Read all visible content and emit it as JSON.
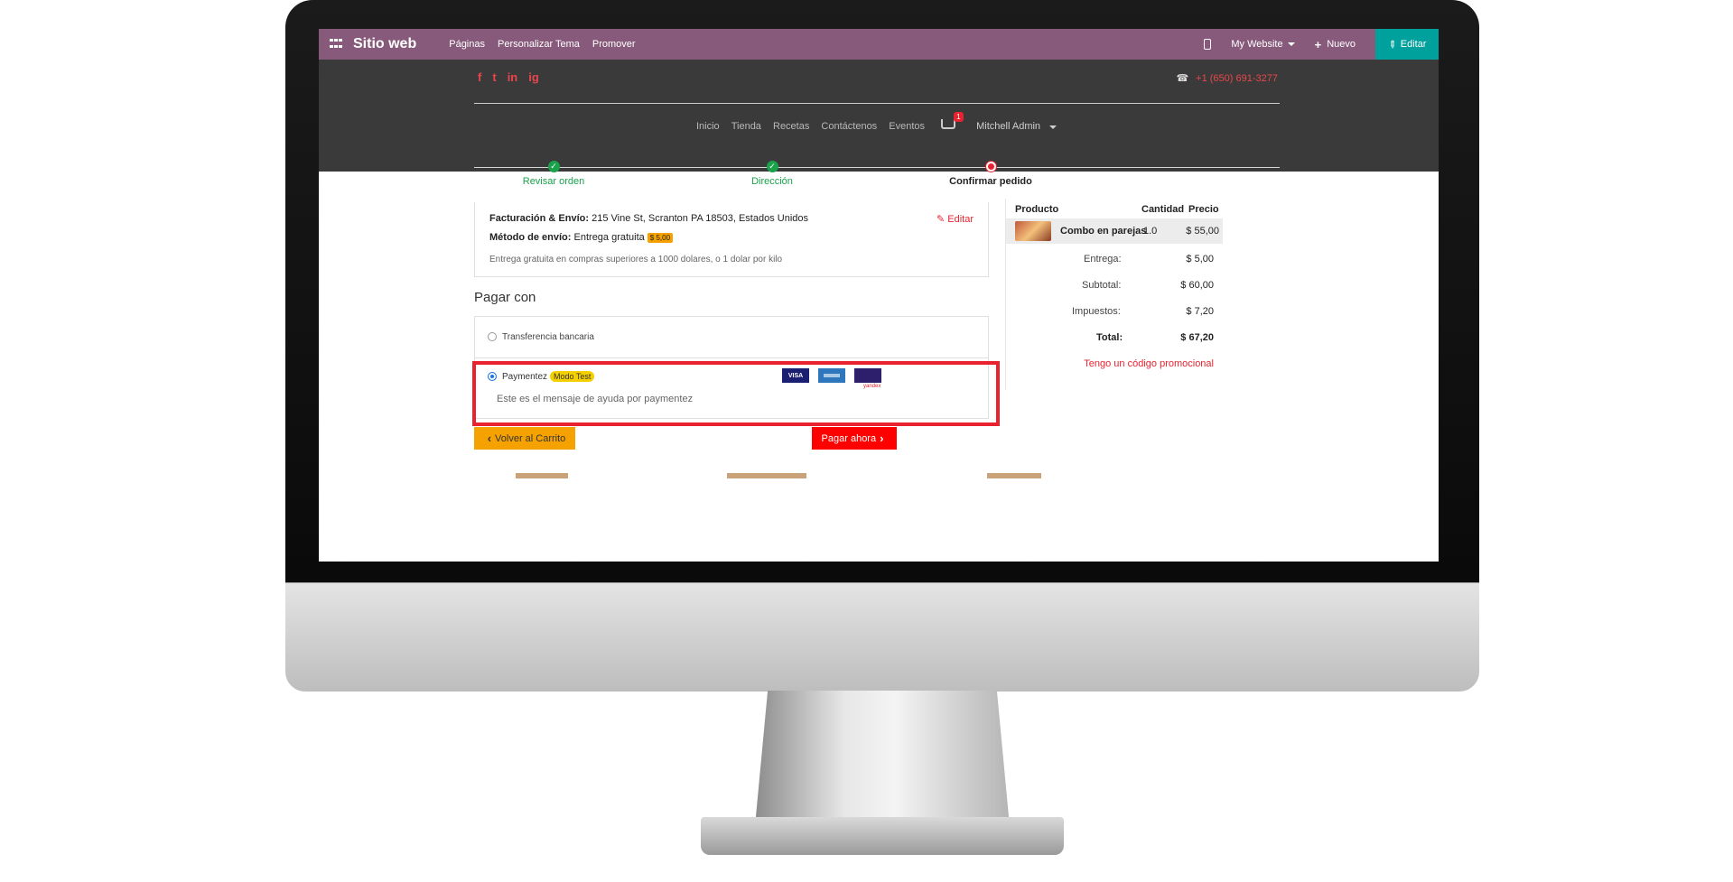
{
  "admin_bar": {
    "brand": "Sitio web",
    "menu": [
      "Páginas",
      "Personalizar Tema",
      "Promover"
    ],
    "website": "My Website",
    "new_label": "Nuevo",
    "edit_label": "Editar"
  },
  "header": {
    "social": [
      "f",
      "t",
      "in",
      "ig"
    ],
    "phone": "+1 (650) 691-3277",
    "nav": [
      "Inicio",
      "Tienda",
      "Recetas",
      "Contáctenos",
      "Eventos"
    ],
    "cart_count": "1",
    "user": "Mitchell Admin"
  },
  "wizard": {
    "steps": [
      "Revisar orden",
      "Dirección",
      "Confirmar pedido"
    ]
  },
  "address": {
    "billing_label": "Facturación & Envío:",
    "billing_value": "215 Vine St, Scranton PA 18503, Estados Unidos",
    "method_label": "Método de envío:",
    "method_value": "Entrega gratuita",
    "method_price": "$ 5,00",
    "note": "Entrega gratuita en compras superiores a 1000 dolares, o 1 dolar por kilo",
    "edit_label": "Editar"
  },
  "payment": {
    "title": "Pagar con",
    "option1": "Transferencia bancaria",
    "option2": "Paymentez",
    "mode_badge": "Modo Test",
    "help_message": "Este es el mensaje de ayuda por paymentez",
    "cards": [
      "VISA",
      "amex",
      "yandex"
    ],
    "yandex_text": "yandex"
  },
  "buttons": {
    "back": "Volver al Carrito",
    "pay": "Pagar ahora"
  },
  "summary": {
    "headers": [
      "Producto",
      "Cantidad",
      "Precio"
    ],
    "product_name": "Combo en parejas",
    "product_qty": "1.0",
    "product_price": "$ 55,00",
    "delivery_label": "Entrega:",
    "delivery_value": "$ 5,00",
    "subtotal_label": "Subtotal:",
    "subtotal_value": "$ 60,00",
    "taxes_label": "Impuestos:",
    "taxes_value": "$ 7,20",
    "total_label": "Total:",
    "total_value": "$ 67,20",
    "promo_link": "Tengo un código promocional"
  },
  "colors": {
    "odoo_purple": "#875a7b",
    "teal": "#00a09d",
    "red": "#e8222f",
    "green": "#1aa24b",
    "orange": "#f5a200"
  }
}
